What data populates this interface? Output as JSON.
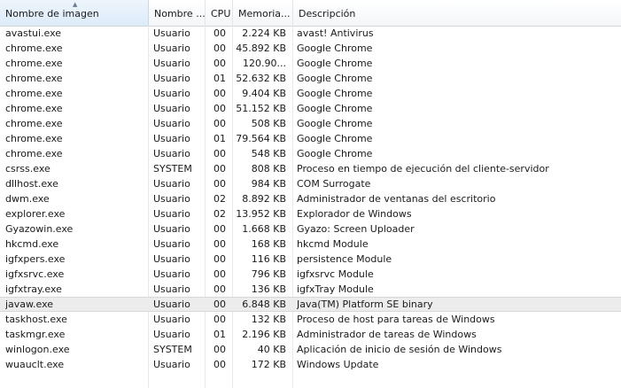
{
  "columns": {
    "image_name": "Nombre de imagen",
    "user": "Nombre ...",
    "cpu": "CPU",
    "memory": "Memoria...",
    "description": "Descripción"
  },
  "rows": [
    {
      "name": "avastui.exe",
      "user": "Usuario",
      "cpu": "00",
      "memory": "2.224 KB",
      "description": "avast! Antivirus"
    },
    {
      "name": "chrome.exe",
      "user": "Usuario",
      "cpu": "00",
      "memory": "45.892 KB",
      "description": "Google Chrome"
    },
    {
      "name": "chrome.exe",
      "user": "Usuario",
      "cpu": "00",
      "memory": "120.90...",
      "description": "Google Chrome"
    },
    {
      "name": "chrome.exe",
      "user": "Usuario",
      "cpu": "01",
      "memory": "52.632 KB",
      "description": "Google Chrome"
    },
    {
      "name": "chrome.exe",
      "user": "Usuario",
      "cpu": "00",
      "memory": "9.404 KB",
      "description": "Google Chrome"
    },
    {
      "name": "chrome.exe",
      "user": "Usuario",
      "cpu": "00",
      "memory": "51.152 KB",
      "description": "Google Chrome"
    },
    {
      "name": "chrome.exe",
      "user": "Usuario",
      "cpu": "00",
      "memory": "508 KB",
      "description": "Google Chrome"
    },
    {
      "name": "chrome.exe",
      "user": "Usuario",
      "cpu": "01",
      "memory": "79.564 KB",
      "description": "Google Chrome"
    },
    {
      "name": "chrome.exe",
      "user": "Usuario",
      "cpu": "00",
      "memory": "548 KB",
      "description": "Google Chrome"
    },
    {
      "name": "csrss.exe",
      "user": "SYSTEM",
      "cpu": "00",
      "memory": "808 KB",
      "description": "Proceso en tiempo de ejecución del cliente-servidor"
    },
    {
      "name": "dllhost.exe",
      "user": "Usuario",
      "cpu": "00",
      "memory": "984 KB",
      "description": "COM Surrogate"
    },
    {
      "name": "dwm.exe",
      "user": "Usuario",
      "cpu": "02",
      "memory": "8.892 KB",
      "description": "Administrador de ventanas del escritorio"
    },
    {
      "name": "explorer.exe",
      "user": "Usuario",
      "cpu": "02",
      "memory": "13.952 KB",
      "description": "Explorador de Windows"
    },
    {
      "name": "Gyazowin.exe",
      "user": "Usuario",
      "cpu": "00",
      "memory": "1.668 KB",
      "description": "Gyazo: Screen Uploader"
    },
    {
      "name": "hkcmd.exe",
      "user": "Usuario",
      "cpu": "00",
      "memory": "168 KB",
      "description": "hkcmd Module"
    },
    {
      "name": "igfxpers.exe",
      "user": "Usuario",
      "cpu": "00",
      "memory": "116 KB",
      "description": "persistence Module"
    },
    {
      "name": "igfxsrvc.exe",
      "user": "Usuario",
      "cpu": "00",
      "memory": "796 KB",
      "description": "igfxsrvc Module"
    },
    {
      "name": "igfxtray.exe",
      "user": "Usuario",
      "cpu": "00",
      "memory": "136 KB",
      "description": "igfxTray Module"
    },
    {
      "name": "javaw.exe",
      "user": "Usuario",
      "cpu": "00",
      "memory": "6.848 KB",
      "description": "Java(TM) Platform SE binary",
      "selected": true
    },
    {
      "name": "taskhost.exe",
      "user": "Usuario",
      "cpu": "00",
      "memory": "132 KB",
      "description": "Proceso de host para tareas de Windows"
    },
    {
      "name": "taskmgr.exe",
      "user": "Usuario",
      "cpu": "01",
      "memory": "2.196 KB",
      "description": "Administrador de tareas de Windows"
    },
    {
      "name": "winlogon.exe",
      "user": "SYSTEM",
      "cpu": "00",
      "memory": "40 KB",
      "description": "Aplicación de inicio de sesión de Windows"
    },
    {
      "name": "wuauclt.exe",
      "user": "Usuario",
      "cpu": "00",
      "memory": "172 KB",
      "description": "Windows Update"
    }
  ]
}
